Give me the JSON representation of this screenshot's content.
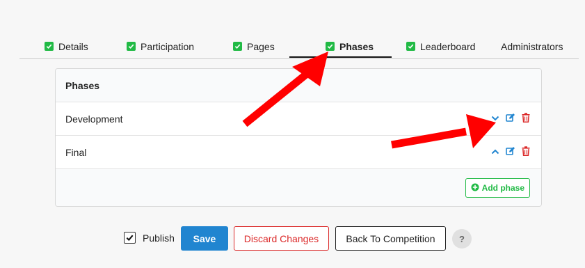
{
  "tabs": [
    {
      "label": "Details",
      "checked": true,
      "active": false
    },
    {
      "label": "Participation",
      "checked": true,
      "active": false
    },
    {
      "label": "Pages",
      "checked": true,
      "active": false
    },
    {
      "label": "Phases",
      "checked": true,
      "active": true
    },
    {
      "label": "Leaderboard",
      "checked": true,
      "active": false
    },
    {
      "label": "Administrators",
      "checked": false,
      "active": false
    }
  ],
  "panel": {
    "header": "Phases",
    "rows": [
      {
        "name": "Development",
        "move_icon": "chevron-down-icon"
      },
      {
        "name": "Final",
        "move_icon": "chevron-up-icon"
      }
    ],
    "add_label": "Add phase"
  },
  "footer": {
    "publish_label": "Publish",
    "publish_checked": true,
    "save_label": "Save",
    "discard_label": "Discard Changes",
    "back_label": "Back To Competition",
    "help_label": "?"
  },
  "colors": {
    "check_green": "#21ba45",
    "primary_blue": "#2185d0",
    "danger_red": "#db2828",
    "icon_blue": "#2185d0",
    "annotation_red": "#ff0000"
  }
}
